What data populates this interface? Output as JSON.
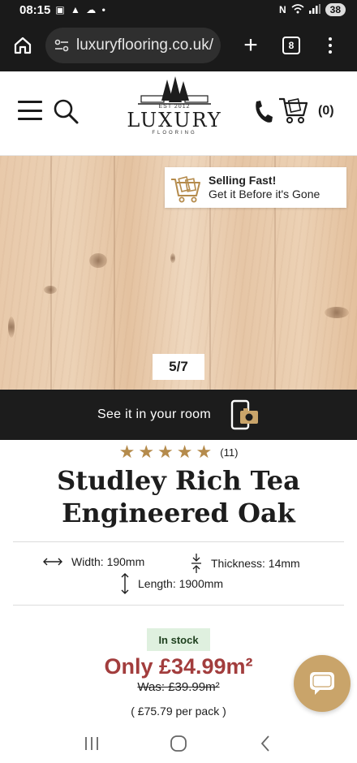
{
  "status_bar": {
    "time": "08:15",
    "battery": "38"
  },
  "browser": {
    "url": "luxuryflooring.co.uk/",
    "tab_count": "8"
  },
  "header": {
    "logo_est": "EST 2012",
    "logo_word": "LUXURY",
    "logo_sub": "FLOORING",
    "cart_count": "(0)"
  },
  "gallery": {
    "badge_title": "Selling Fast!",
    "badge_subtitle": "Get it Before it's Gone",
    "counter": "5/7"
  },
  "room_bar": {
    "label": "See it in your room"
  },
  "product": {
    "rating_stars": 5,
    "review_count": "(11)",
    "title": "Studley Rich Tea Engineered Oak",
    "width": "Width: 190mm",
    "thickness": "Thickness: 14mm",
    "length": "Length: 1900mm",
    "stock": "In stock",
    "price_now": "Only £34.99m²",
    "price_was": "Was: £39.99m²",
    "price_pack": "( £75.79 per pack )"
  },
  "colors": {
    "accent_gold": "#c9a46a",
    "star": "#b58b4c",
    "price_red": "#a23d3d",
    "stock_bg": "#dff0df"
  }
}
